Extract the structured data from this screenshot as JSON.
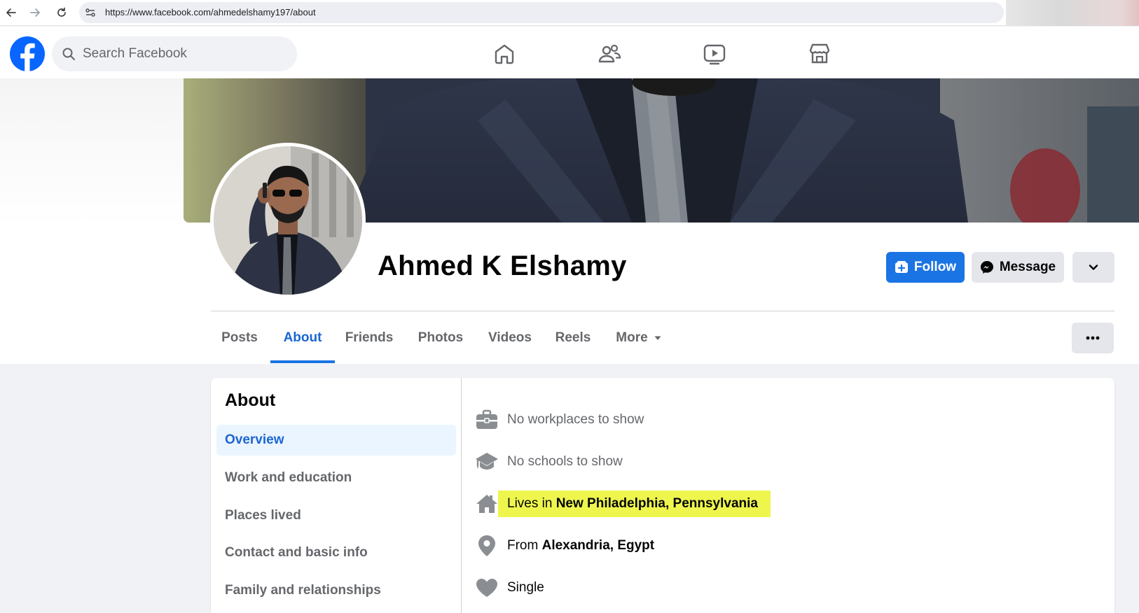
{
  "browser": {
    "url": "https://www.facebook.com/ahmedelshamy197/about"
  },
  "header": {
    "search_placeholder": "Search Facebook",
    "nav_icons": [
      "home-icon",
      "friends-icon",
      "video-icon",
      "marketplace-icon"
    ]
  },
  "profile": {
    "name": "Ahmed K Elshamy",
    "follow_label": "Follow",
    "message_label": "Message"
  },
  "tabs": [
    {
      "label": "Posts",
      "active": false
    },
    {
      "label": "About",
      "active": true
    },
    {
      "label": "Friends",
      "active": false
    },
    {
      "label": "Photos",
      "active": false
    },
    {
      "label": "Videos",
      "active": false
    },
    {
      "label": "Reels",
      "active": false
    },
    {
      "label": "More",
      "active": false
    }
  ],
  "about": {
    "title": "About",
    "sidebar": [
      {
        "label": "Overview",
        "active": true
      },
      {
        "label": "Work and education",
        "active": false
      },
      {
        "label": "Places lived",
        "active": false
      },
      {
        "label": "Contact and basic info",
        "active": false
      },
      {
        "label": "Family and relationships",
        "active": false
      }
    ],
    "overview": {
      "work": "No workplaces to show",
      "school": "No schools to show",
      "lives_prefix": "Lives in ",
      "lives_place": "New Philadelphia, Pennsylvania",
      "from_prefix": "From ",
      "from_place": "Alexandria, Egypt",
      "relationship": "Single"
    }
  },
  "colors": {
    "brand_blue": "#1b74e4",
    "active_text": "#1b66d2",
    "highlight": "#eef64e"
  }
}
